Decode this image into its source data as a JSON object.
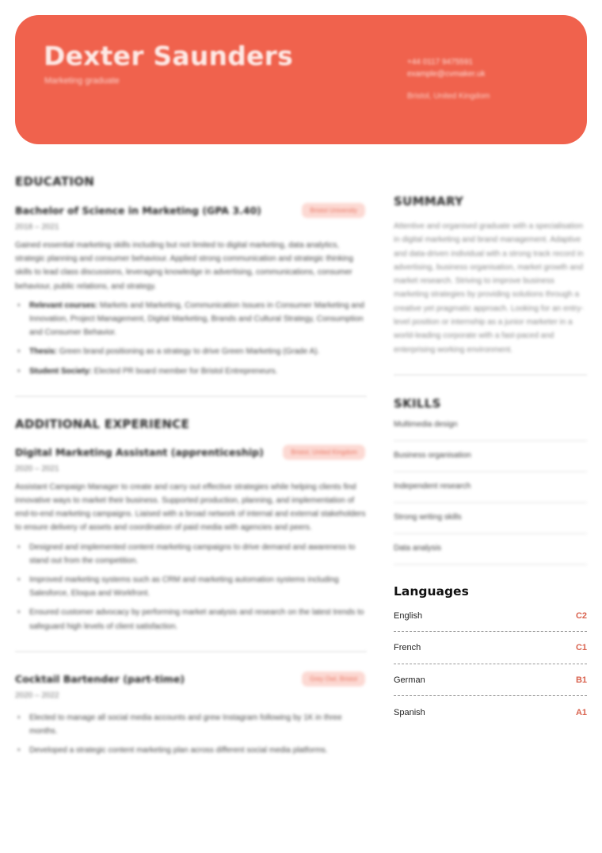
{
  "theme": {
    "accent": "#f0624d",
    "accent_text": "#d9634f",
    "badge_bg": "#fcd9d3"
  },
  "header": {
    "name": "Dexter Saunders",
    "role": "Marketing graduate",
    "phone": "+44 0117 9475591",
    "email": "example@cvmaker.uk",
    "location": "Bristol, United Kingdom"
  },
  "education": {
    "title": "EDUCATION",
    "entries": [
      {
        "title": "Bachelor of Science in Marketing (GPA 3.40)",
        "badge": "Bristol University",
        "dates": "2018 – 2021",
        "description": "Gained essential marketing skills including but not limited to digital marketing, data analytics, strategic planning and consumer behaviour. Applied strong communication and strategic thinking skills to lead class discussions, leveraging knowledge in advertising, communications, consumer behaviour, public relations, and strategy.",
        "bullets": [
          {
            "label": "Relevant courses:",
            "text": " Markets and Marketing, Communication Issues in Consumer Marketing and Innovation, Project Management, Digital Marketing, Brands and Cultural Strategy, Consumption and Consumer Behavior."
          },
          {
            "label": "Thesis:",
            "text": " Green brand positioning as a strategy to drive Green Marketing (Grade A)."
          },
          {
            "label": "Student Society:",
            "text": " Elected PR board member for Bristol Entrepreneurs."
          }
        ]
      }
    ]
  },
  "experience": {
    "title": "ADDITIONAL EXPERIENCE",
    "entries": [
      {
        "title": "Digital Marketing Assistant (apprenticeship)",
        "badge": "Bristol, United Kingdom",
        "dates": "2020 – 2021",
        "description": "Assistant Campaign Manager to create and carry out effective strategies while helping clients find innovative ways to market their business. Supported production, planning, and implementation of end-to-end marketing campaigns. Liaised with a broad network of internal and external stakeholders to ensure delivery of assets and coordination of paid media with agencies and peers.",
        "bullets": [
          {
            "label": "",
            "text": "Designed and implemented content marketing campaigns to drive demand and awareness to stand out from the competition."
          },
          {
            "label": "",
            "text": "Improved marketing systems such as CRM and marketing automation systems including Salesforce, Eloqua and Workfront."
          },
          {
            "label": "",
            "text": "Ensured customer advocacy by performing market analysis and research on the latest trends to safeguard high levels of client satisfaction."
          }
        ]
      },
      {
        "title": "Cocktail Bartender (part-time)",
        "badge": "Grey Owl, Bristol",
        "dates": "2020 – 2022",
        "description": "",
        "bullets": [
          {
            "label": "",
            "text": "Elected to manage all social media accounts and grew Instagram following by 1K in three months."
          },
          {
            "label": "",
            "text": "Developed a strategic content marketing plan across different social media platforms."
          }
        ]
      }
    ]
  },
  "summary": {
    "title": "SUMMARY",
    "text": "Attentive and organised graduate with a specialisation in digital marketing and brand management. Adaptive and data-driven individual with a strong track record in advertising, business organisation, market growth and market research. Striving to improve business marketing strategies by providing solutions through a creative yet pragmatic approach. Looking for an entry-level position or internship as a junior marketer in a world-leading corporate with a fast-paced and enterprising working environment."
  },
  "skills": {
    "title": "SKILLS",
    "items": [
      "Multimedia design",
      "Business organisation",
      "Independent research",
      "Strong writing skills",
      "Data analysis"
    ]
  },
  "languages": {
    "title": "Languages",
    "items": [
      {
        "name": "English",
        "level": "C2"
      },
      {
        "name": "French",
        "level": "C1"
      },
      {
        "name": "German",
        "level": "B1"
      },
      {
        "name": "Spanish",
        "level": "A1"
      }
    ]
  }
}
